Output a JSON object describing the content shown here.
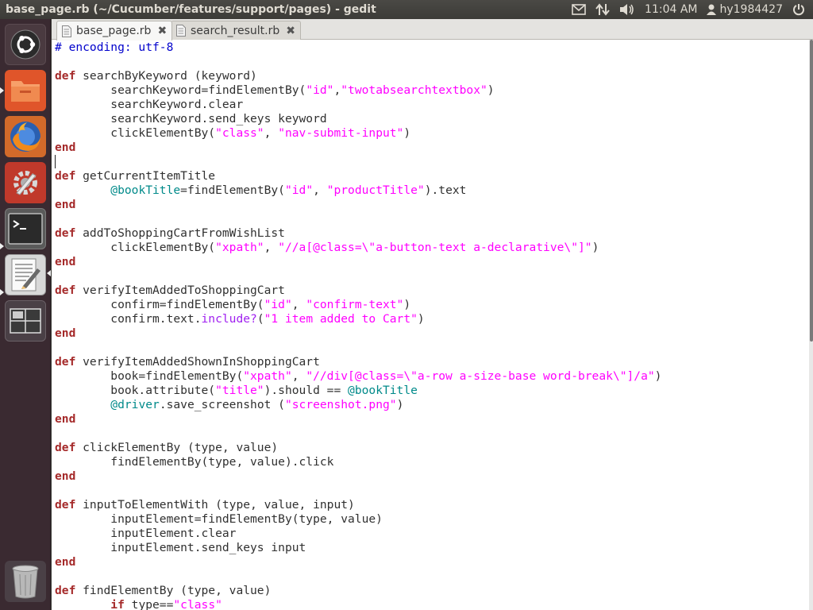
{
  "window_title": "base_page.rb (~/Cucumber/features/support/pages) - gedit",
  "panel": {
    "indicators": [
      "mail-icon",
      "network-transfer-icon",
      "volume-icon"
    ],
    "clock": "11:04 AM",
    "user": "hy1984427"
  },
  "launcher": {
    "items": [
      {
        "name": "dash-home",
        "icon": "ubuntu-logo-icon"
      },
      {
        "name": "files",
        "icon": "folder-icon"
      },
      {
        "name": "firefox",
        "icon": "firefox-icon"
      },
      {
        "name": "system-settings",
        "icon": "settings-icon"
      },
      {
        "name": "terminal",
        "icon": "terminal-icon"
      },
      {
        "name": "gedit",
        "icon": "text-editor-icon"
      },
      {
        "name": "workspace-switcher",
        "icon": "workspace-icon"
      },
      {
        "name": "trash",
        "icon": "trash-icon"
      }
    ]
  },
  "tabs": [
    {
      "label": "base_page.rb",
      "active": true
    },
    {
      "label": "search_result.rb",
      "active": false
    }
  ],
  "code_lines": [
    [
      [
        "comment",
        "# encoding: utf-8"
      ]
    ],
    [],
    [
      [
        "keyword",
        "def"
      ],
      [
        "text",
        " searchByKeyword (keyword)"
      ]
    ],
    [
      [
        "text",
        "        searchKeyword=findElementBy("
      ],
      [
        "string",
        "\"id\""
      ],
      [
        "text",
        ","
      ],
      [
        "string",
        "\"twotabsearchtextbox\""
      ],
      [
        "text",
        ")"
      ]
    ],
    [
      [
        "text",
        "        searchKeyword.clear"
      ]
    ],
    [
      [
        "text",
        "        searchKeyword.send_keys keyword"
      ]
    ],
    [
      [
        "text",
        "        clickElementBy("
      ],
      [
        "string",
        "\"class\""
      ],
      [
        "text",
        ", "
      ],
      [
        "string",
        "\"nav-submit-input\""
      ],
      [
        "text",
        ")"
      ]
    ],
    [
      [
        "keyword",
        "end"
      ]
    ],
    [],
    [
      [
        "keyword",
        "def"
      ],
      [
        "text",
        " getCurrentItemTitle"
      ]
    ],
    [
      [
        "text",
        "        "
      ],
      [
        "ivar",
        "@bookTitle"
      ],
      [
        "text",
        "=findElementBy("
      ],
      [
        "string",
        "\"id\""
      ],
      [
        "text",
        ", "
      ],
      [
        "string",
        "\"productTitle\""
      ],
      [
        "text",
        ").text"
      ]
    ],
    [
      [
        "keyword",
        "end"
      ]
    ],
    [],
    [
      [
        "keyword",
        "def"
      ],
      [
        "text",
        " addToShoppingCartFromWishList"
      ]
    ],
    [
      [
        "text",
        "        clickElementBy("
      ],
      [
        "string",
        "\"xpath\""
      ],
      [
        "text",
        ", "
      ],
      [
        "string",
        "\"//a[@class=\\\"a-button-text a-declarative\\\"]\""
      ],
      [
        "text",
        ")"
      ]
    ],
    [
      [
        "keyword",
        "end"
      ]
    ],
    [],
    [
      [
        "keyword",
        "def"
      ],
      [
        "text",
        " verifyItemAddedToShoppingCart"
      ]
    ],
    [
      [
        "text",
        "        confirm=findElementBy("
      ],
      [
        "string",
        "\"id\""
      ],
      [
        "text",
        ", "
      ],
      [
        "string",
        "\"confirm-text\""
      ],
      [
        "text",
        ")"
      ]
    ],
    [
      [
        "text",
        "        confirm.text."
      ],
      [
        "method",
        "include?"
      ],
      [
        "text",
        "("
      ],
      [
        "string",
        "\"1 item added to Cart\""
      ],
      [
        "text",
        ")"
      ]
    ],
    [
      [
        "keyword",
        "end"
      ]
    ],
    [],
    [
      [
        "keyword",
        "def"
      ],
      [
        "text",
        " verifyItemAddedShownInShoppingCart"
      ]
    ],
    [
      [
        "text",
        "        book=findElementBy("
      ],
      [
        "string",
        "\"xpath\""
      ],
      [
        "text",
        ", "
      ],
      [
        "string",
        "\"//div[@class=\\\"a-row a-size-base word-break\\\"]/a\""
      ],
      [
        "text",
        ")"
      ]
    ],
    [
      [
        "text",
        "        book.attribute("
      ],
      [
        "string",
        "\"title\""
      ],
      [
        "text",
        ").should == "
      ],
      [
        "ivar",
        "@bookTitle"
      ]
    ],
    [
      [
        "text",
        "        "
      ],
      [
        "ivar",
        "@driver"
      ],
      [
        "text",
        ".save_screenshot ("
      ],
      [
        "string",
        "\"screenshot.png\""
      ],
      [
        "text",
        ")"
      ]
    ],
    [
      [
        "keyword",
        "end"
      ]
    ],
    [],
    [
      [
        "keyword",
        "def"
      ],
      [
        "text",
        " clickElementBy (type, value)"
      ]
    ],
    [
      [
        "text",
        "        findElementBy(type, value).click"
      ]
    ],
    [
      [
        "keyword",
        "end"
      ]
    ],
    [],
    [
      [
        "keyword",
        "def"
      ],
      [
        "text",
        " inputToElementWith (type, value, input)"
      ]
    ],
    [
      [
        "text",
        "        inputElement=findElementBy(type, value)"
      ]
    ],
    [
      [
        "text",
        "        inputElement.clear"
      ]
    ],
    [
      [
        "text",
        "        inputElement.send_keys input"
      ]
    ],
    [
      [
        "keyword",
        "end"
      ]
    ],
    [],
    [
      [
        "keyword",
        "def"
      ],
      [
        "text",
        " findElementBy (type, value)"
      ]
    ],
    [
      [
        "text",
        "        "
      ],
      [
        "keyword",
        "if"
      ],
      [
        "text",
        " type=="
      ],
      [
        "string",
        "\"class\""
      ]
    ]
  ]
}
